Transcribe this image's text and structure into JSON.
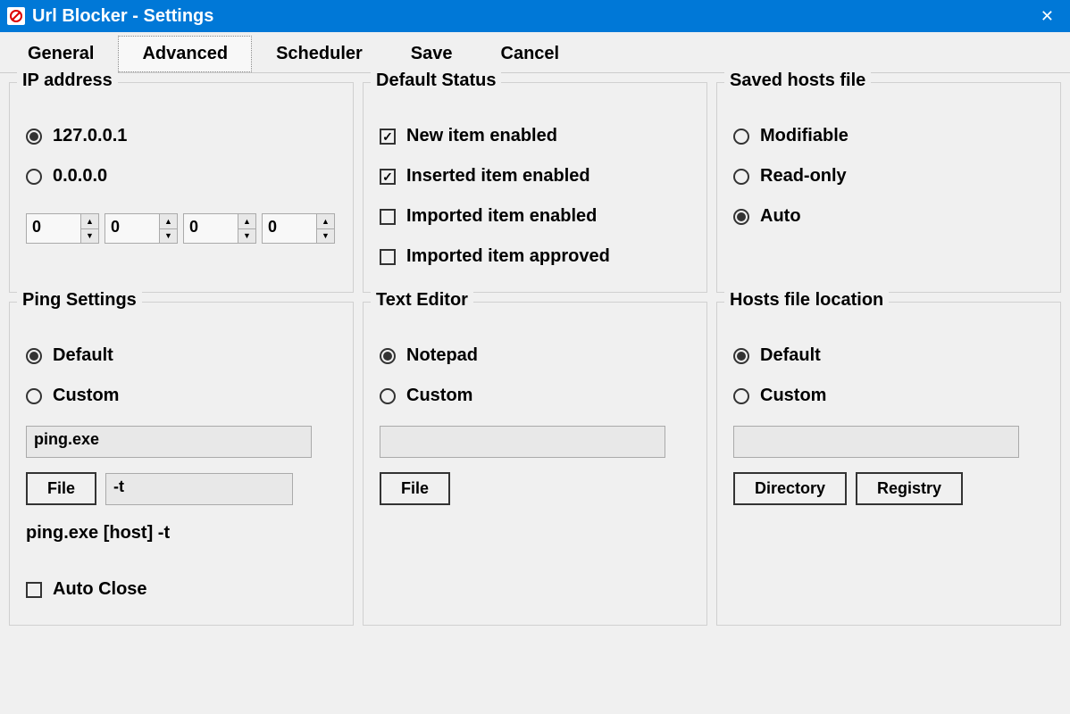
{
  "window": {
    "title": "Url Blocker - Settings"
  },
  "tabs": {
    "general": "General",
    "advanced": "Advanced",
    "scheduler": "Scheduler",
    "save": "Save",
    "cancel": "Cancel"
  },
  "ip_address": {
    "title": "IP address",
    "opt_local": "127.0.0.1",
    "opt_zero": "0.0.0.0",
    "octets": [
      "0",
      "0",
      "0",
      "0"
    ]
  },
  "default_status": {
    "title": "Default Status",
    "new_item": "New item enabled",
    "inserted_item": "Inserted item enabled",
    "imported_enabled": "Imported item enabled",
    "imported_approved": "Imported item approved"
  },
  "saved_hosts": {
    "title": "Saved hosts file",
    "modifiable": "Modifiable",
    "readonly": "Read-only",
    "auto": "Auto"
  },
  "ping": {
    "title": "Ping Settings",
    "opt_default": "Default",
    "opt_custom": "Custom",
    "cmd": "ping.exe",
    "file_btn": "File",
    "args": "-t",
    "preview": "ping.exe [host] -t",
    "auto_close": "Auto Close"
  },
  "editor": {
    "title": "Text Editor",
    "opt_notepad": "Notepad",
    "opt_custom": "Custom",
    "path": "",
    "file_btn": "File"
  },
  "hosts_loc": {
    "title": "Hosts file location",
    "opt_default": "Default",
    "opt_custom": "Custom",
    "path": "",
    "dir_btn": "Directory",
    "reg_btn": "Registry"
  }
}
